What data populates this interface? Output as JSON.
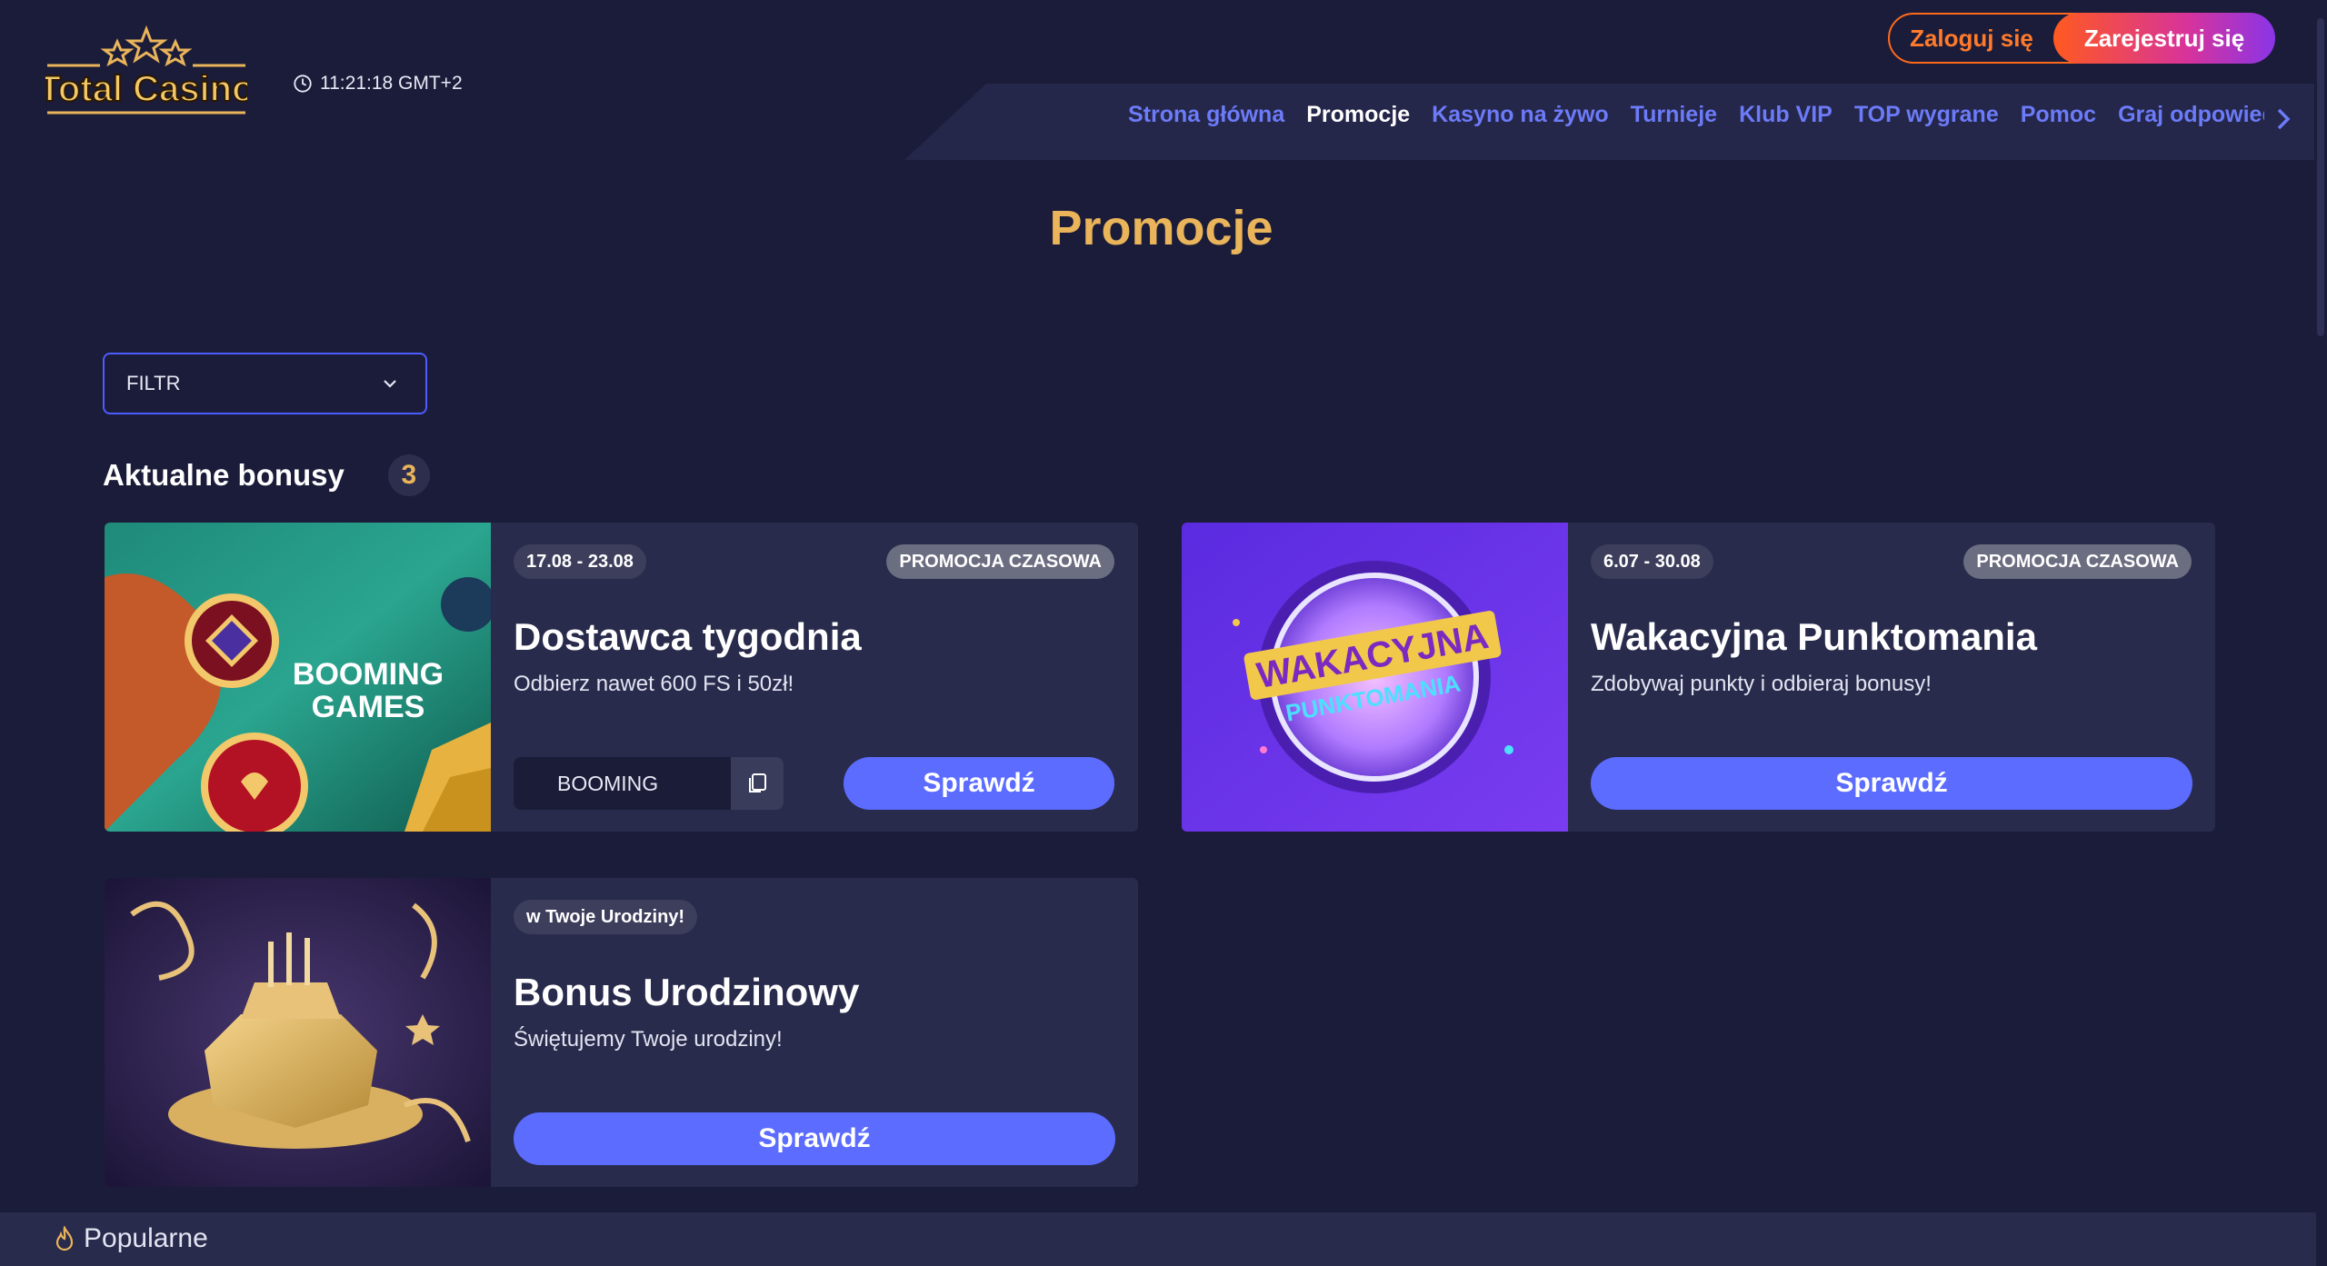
{
  "header": {
    "logo_text": "Total Casino",
    "clock": "11:21:18 GMT+2",
    "login_label": "Zaloguj się",
    "register_label": "Zarejestruj się"
  },
  "nav": {
    "items": [
      {
        "label": "Strona główna",
        "active": false
      },
      {
        "label": "Promocje",
        "active": true
      },
      {
        "label": "Kasyno na żywo",
        "active": false
      },
      {
        "label": "Turnieje",
        "active": false
      },
      {
        "label": "Klub VIP",
        "active": false
      },
      {
        "label": "TOP wygrane",
        "active": false
      },
      {
        "label": "Pomoc",
        "active": false
      },
      {
        "label": "Graj odpowiedzialnie",
        "active": false
      }
    ]
  },
  "page": {
    "title": "Promocje",
    "filter_label": "FILTR",
    "section_title": "Aktualne bonusy",
    "section_count": "3"
  },
  "cards": [
    {
      "date": "17.08 - 23.08",
      "tag": "PROMOCJA CZASOWA",
      "title": "Dostawca tygodnia",
      "subtitle": "Odbierz nawet 600 FS i 50zł!",
      "code": "BOOMING",
      "button": "Sprawdź",
      "image_text_1": "BOOMING",
      "image_text_2": "GAMES"
    },
    {
      "date": "6.07 - 30.08",
      "tag": "PROMOCJA CZASOWA",
      "title": "Wakacyjna Punktomania",
      "subtitle": "Zdobywaj punkty i odbieraj bonusy!",
      "button": "Sprawdź",
      "image_text_1": "WAKACYJNA",
      "image_text_2": "PUNKTOMANIA"
    },
    {
      "date": "w Twoje Urodziny!",
      "title": "Bonus Urodzinowy",
      "subtitle": "Świętujemy Twoje urodziny!",
      "button": "Sprawdź"
    }
  ],
  "footer": {
    "popular_label": "Popularne"
  },
  "colors": {
    "background": "#1b1c3a",
    "card": "#292b4c",
    "accent_blue": "#5b6cff",
    "title_gold": "#e9b45a",
    "login_orange": "#ff6a1a"
  }
}
